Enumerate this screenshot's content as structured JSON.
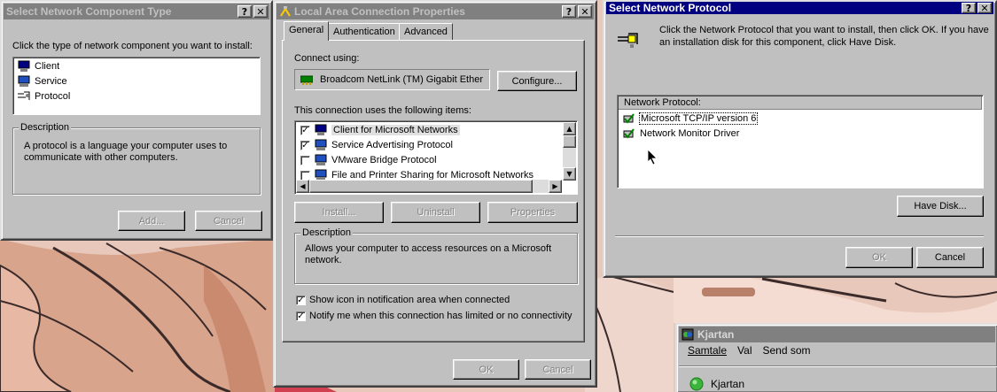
{
  "dialog_component": {
    "title": "Select Network Component Type",
    "instruction": "Click the type of network component you want to install:",
    "items": [
      {
        "label": "Client"
      },
      {
        "label": "Service"
      },
      {
        "label": "Protocol"
      }
    ],
    "description_label": "Description",
    "description_text": "A protocol is a language your computer uses to communicate with other computers.",
    "add_label": "Add...",
    "cancel_label": "Cancel"
  },
  "dialog_lan": {
    "title": "Local Area Connection Properties",
    "tabs": [
      {
        "label": "General"
      },
      {
        "label": "Authentication"
      },
      {
        "label": "Advanced"
      }
    ],
    "connect_using_label": "Connect using:",
    "adapter_name": "Broadcom NetLink (TM) Gigabit Ether",
    "configure_label": "Configure...",
    "items_label": "This connection uses the following items:",
    "items": [
      {
        "label": "Client for Microsoft Networks",
        "checked": true
      },
      {
        "label": "Service Advertising Protocol",
        "checked": true
      },
      {
        "label": "VMware Bridge Protocol",
        "checked": false
      },
      {
        "label": "File and Printer Sharing for Microsoft Networks",
        "checked": false
      }
    ],
    "install_label": "Install...",
    "uninstall_label": "Uninstall",
    "properties_label": "Properties",
    "description_label": "Description",
    "description_text": "Allows your computer to access resources on a Microsoft network.",
    "show_icon_label": "Show icon in notification area when connected",
    "notify_label": "Notify me when this connection has limited or no connectivity",
    "ok_label": "OK",
    "cancel_label": "Cancel"
  },
  "dialog_protocol": {
    "title": "Select Network Protocol",
    "instruction": "Click the Network Protocol that you want to install, then click OK. If you have an installation disk for this component, click Have Disk.",
    "list_header": "Network Protocol:",
    "items": [
      {
        "label": "Microsoft TCP/IP version 6"
      },
      {
        "label": "Network Monitor Driver"
      }
    ],
    "have_disk_label": "Have Disk...",
    "ok_label": "OK",
    "cancel_label": "Cancel"
  },
  "messenger": {
    "title": "Kjartan",
    "menu": [
      {
        "label": "Samtale"
      },
      {
        "label": "Val"
      },
      {
        "label": "Send som"
      }
    ],
    "contact": "Kjartan",
    "status_color": "#3cb43c"
  }
}
